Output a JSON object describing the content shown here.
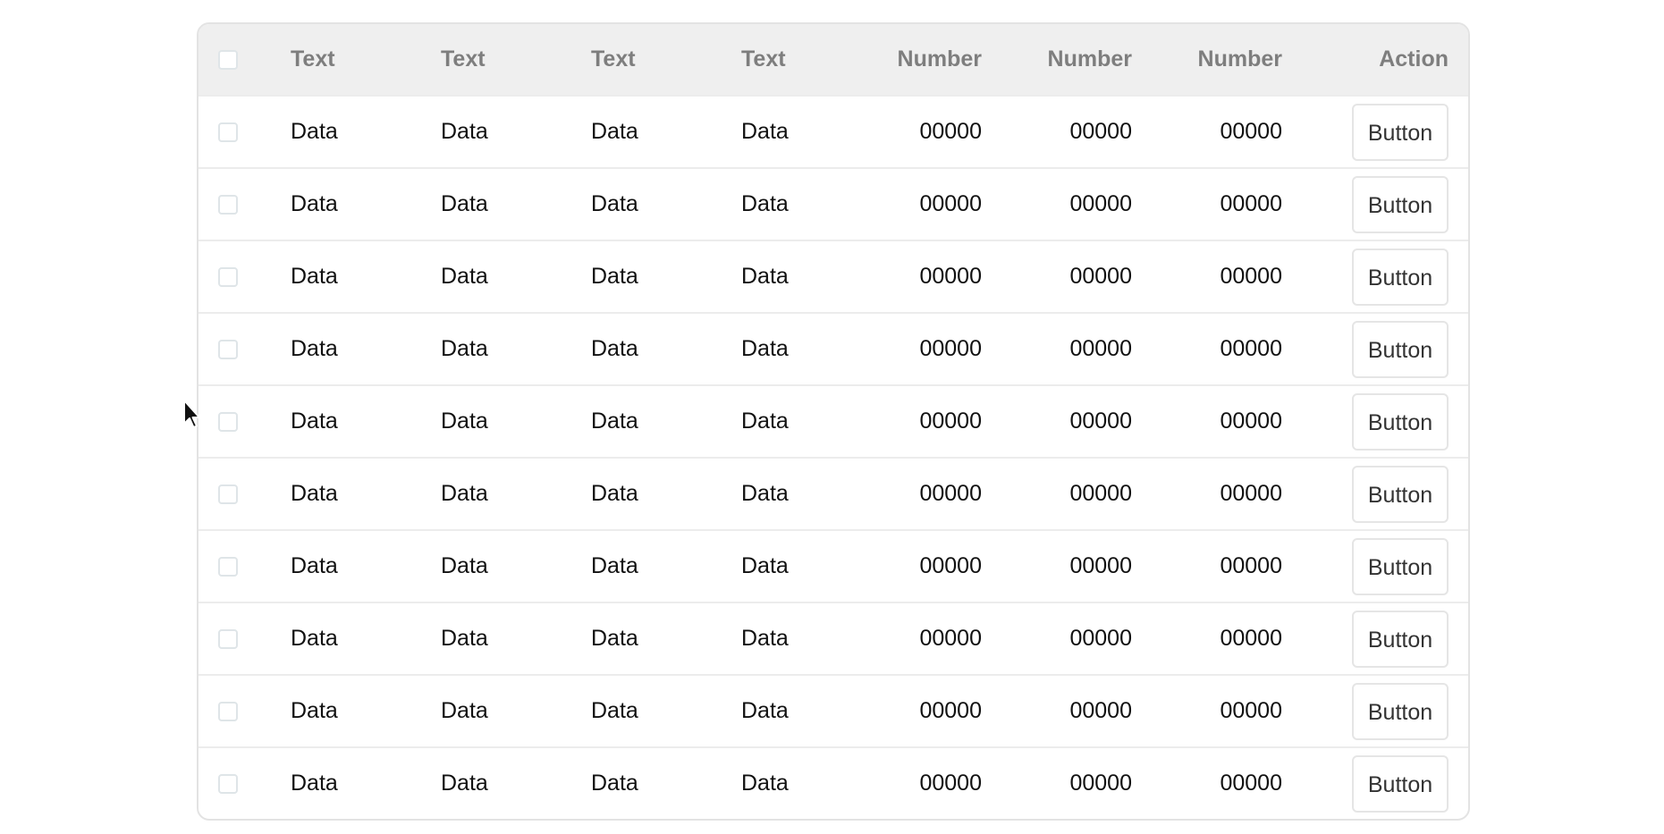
{
  "table": {
    "headers": {
      "text1": "Text",
      "text2": "Text",
      "text3": "Text",
      "text4": "Text",
      "num1": "Number",
      "num2": "Number",
      "num3": "Number",
      "action": "Action"
    },
    "rows": [
      {
        "t1": "Data",
        "t2": "Data",
        "t3": "Data",
        "t4": "Data",
        "n1": "00000",
        "n2": "00000",
        "n3": "00000",
        "button": "Button"
      },
      {
        "t1": "Data",
        "t2": "Data",
        "t3": "Data",
        "t4": "Data",
        "n1": "00000",
        "n2": "00000",
        "n3": "00000",
        "button": "Button"
      },
      {
        "t1": "Data",
        "t2": "Data",
        "t3": "Data",
        "t4": "Data",
        "n1": "00000",
        "n2": "00000",
        "n3": "00000",
        "button": "Button"
      },
      {
        "t1": "Data",
        "t2": "Data",
        "t3": "Data",
        "t4": "Data",
        "n1": "00000",
        "n2": "00000",
        "n3": "00000",
        "button": "Button"
      },
      {
        "t1": "Data",
        "t2": "Data",
        "t3": "Data",
        "t4": "Data",
        "n1": "00000",
        "n2": "00000",
        "n3": "00000",
        "button": "Button"
      },
      {
        "t1": "Data",
        "t2": "Data",
        "t3": "Data",
        "t4": "Data",
        "n1": "00000",
        "n2": "00000",
        "n3": "00000",
        "button": "Button"
      },
      {
        "t1": "Data",
        "t2": "Data",
        "t3": "Data",
        "t4": "Data",
        "n1": "00000",
        "n2": "00000",
        "n3": "00000",
        "button": "Button"
      },
      {
        "t1": "Data",
        "t2": "Data",
        "t3": "Data",
        "t4": "Data",
        "n1": "00000",
        "n2": "00000",
        "n3": "00000",
        "button": "Button"
      },
      {
        "t1": "Data",
        "t2": "Data",
        "t3": "Data",
        "t4": "Data",
        "n1": "00000",
        "n2": "00000",
        "n3": "00000",
        "button": "Button"
      },
      {
        "t1": "Data",
        "t2": "Data",
        "t3": "Data",
        "t4": "Data",
        "n1": "00000",
        "n2": "00000",
        "n3": "00000",
        "button": "Button"
      }
    ]
  },
  "colors": {
    "header_bg": "#efefef",
    "header_text": "#7e7e7e",
    "border": "#e3e3e3"
  },
  "icons": {
    "cursor": "mouse-pointer-icon"
  }
}
